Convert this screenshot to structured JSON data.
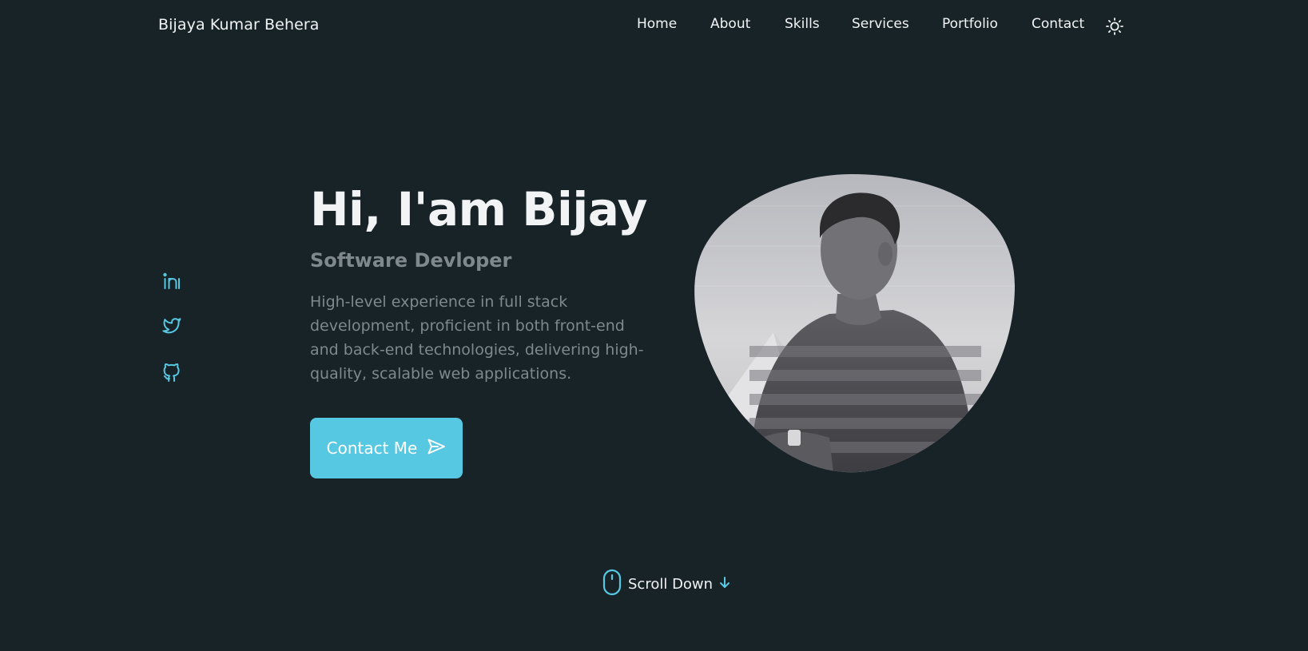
{
  "header": {
    "logo": "Bijaya Kumar Behera",
    "nav": [
      {
        "label": "Home",
        "name": "nav-home"
      },
      {
        "label": "About",
        "name": "nav-about"
      },
      {
        "label": "Skills",
        "name": "nav-skills"
      },
      {
        "label": "Services",
        "name": "nav-services"
      },
      {
        "label": "Portfolio",
        "name": "nav-portfolio"
      },
      {
        "label": "Contact",
        "name": "nav-contact"
      }
    ],
    "theme_icon": "sun-icon"
  },
  "social": [
    {
      "name": "linkedin-icon"
    },
    {
      "name": "twitter-icon"
    },
    {
      "name": "github-icon"
    }
  ],
  "hero": {
    "title": "Hi, I'am Bijay",
    "subtitle": "Software Devloper",
    "description": "High-level experience in full stack development, proficient in both front-end and back-end technologies, delivering high-quality, scalable web applications.",
    "contact_button": "Contact Me",
    "contact_icon": "send-icon"
  },
  "scroll": {
    "label": "Scroll Down",
    "mouse_icon": "mouse-icon",
    "arrow_icon": "arrow-down-icon"
  },
  "colors": {
    "background": "#182328",
    "accent": "#56c8e1",
    "text": "#f1f3f4",
    "muted": "#7f888c"
  }
}
